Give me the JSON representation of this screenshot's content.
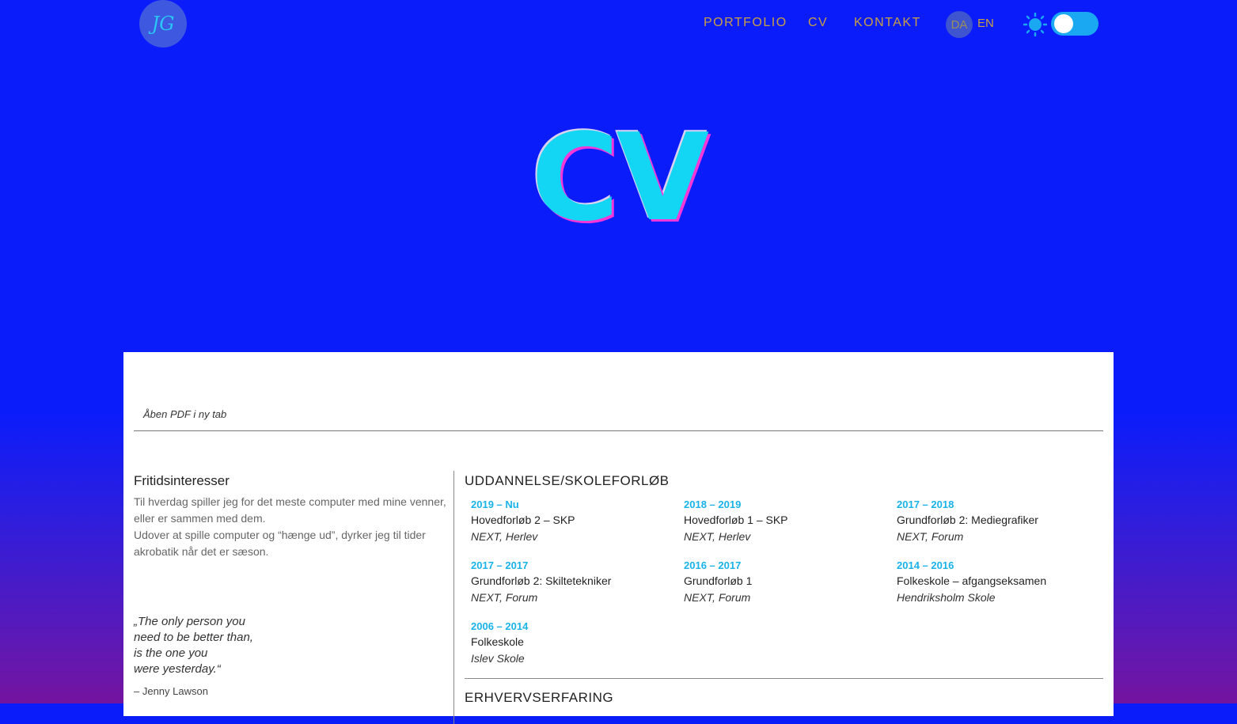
{
  "header": {
    "logo_text": "JG",
    "nav": [
      {
        "label": "PORTFOLIO"
      },
      {
        "label": "CV"
      },
      {
        "label": "KONTAKT"
      }
    ],
    "lang_active": "DA",
    "lang_other": "EN",
    "theme_toggle": {
      "state": "light",
      "icons": [
        "sun-icon",
        "moon-icon"
      ]
    }
  },
  "hero": {
    "title": "CV"
  },
  "card": {
    "pdf_link": "Åben PDF i ny tab",
    "leisure": {
      "heading": "Fritidsinteresser",
      "text1": "Til hverdag spiller jeg for det meste computer med mine venner, eller er sammen med dem.",
      "text2": "Udover at spille computer og “hænge ud”, dyrker jeg til tider akrobatik når det er sæson."
    },
    "quote": {
      "lines": [
        "„The only person you",
        "need to be better than,",
        "is the one you",
        "were yesterday.“"
      ],
      "author": "– Jenny Lawson"
    },
    "education": {
      "heading": "UDDANNELSE/SKOLEFORLØB",
      "items": [
        {
          "years": "2019 – Nu",
          "name": "Hovedforløb 2 – SKP",
          "place": "NEXT, Herlev"
        },
        {
          "years": "2018 – 2019",
          "name": "Hovedforløb 1 – SKP",
          "place": "NEXT, Herlev"
        },
        {
          "years": "2017 – 2018",
          "name": "Grundforløb 2: Mediegrafiker",
          "place": "NEXT, Forum"
        },
        {
          "years": "2017 – 2017",
          "name": "Grundforløb 2: Skiltetekniker",
          "place": "NEXT, Forum"
        },
        {
          "years": "2016 – 2017",
          "name": "Grundforløb 1",
          "place": "NEXT, Forum"
        },
        {
          "years": "2014 – 2016",
          "name": "Folkeskole – afgangseksamen",
          "place": "Hendriksholm Skole"
        },
        {
          "years": "2006 – 2014",
          "name": "Folkeskole",
          "place": "Islev Skole"
        }
      ]
    },
    "work": {
      "heading": "ERHVERVSERFARING"
    }
  },
  "colors": {
    "background": "#0b1cfb",
    "nav_text": "#c8a043",
    "accent": "#19b3ea",
    "hero_fill": "#13d6f5",
    "hero_shadow": "#f536d8"
  }
}
